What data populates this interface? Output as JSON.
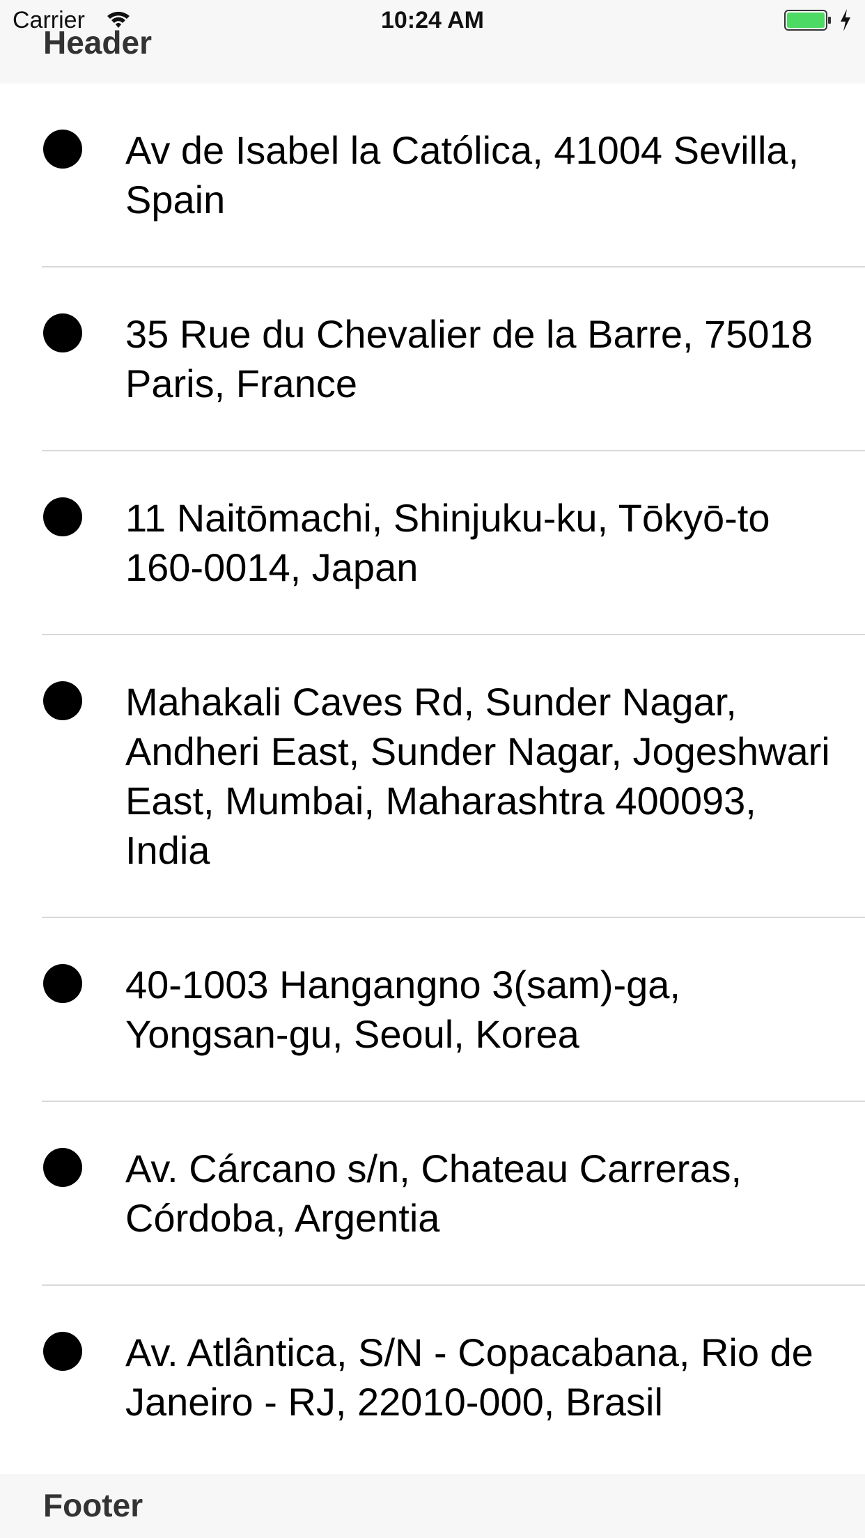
{
  "status_bar": {
    "carrier": "Carrier",
    "time": "10:24 AM",
    "icons": [
      "wifi-icon",
      "battery-icon",
      "charging-icon"
    ],
    "battery_color": "#4cd964"
  },
  "header": {
    "title": "Header"
  },
  "addresses": [
    "Av de Isabel la Católica, 41004 Sevilla, Spain",
    "35 Rue du Chevalier de la Barre, 75018 Paris, France",
    "11 Naitōmachi, Shinjuku-ku, Tōkyō-to 160-0014, Japan",
    "Mahakali Caves Rd, Sunder Nagar, Andheri East, Sunder Nagar, Jogeshwari East, Mumbai, Maharashtra 400093, India",
    "40-1003 Hangangno 3(sam)-ga, Yongsan-gu, Seoul, Korea",
    "Av. Cárcano s/n, Chateau Carreras, Córdoba, Argentia",
    "Av. Atlântica, S/N - Copacabana, Rio de Janeiro - RJ, 22010-000, Brasil"
  ],
  "footer": {
    "title": "Footer"
  }
}
